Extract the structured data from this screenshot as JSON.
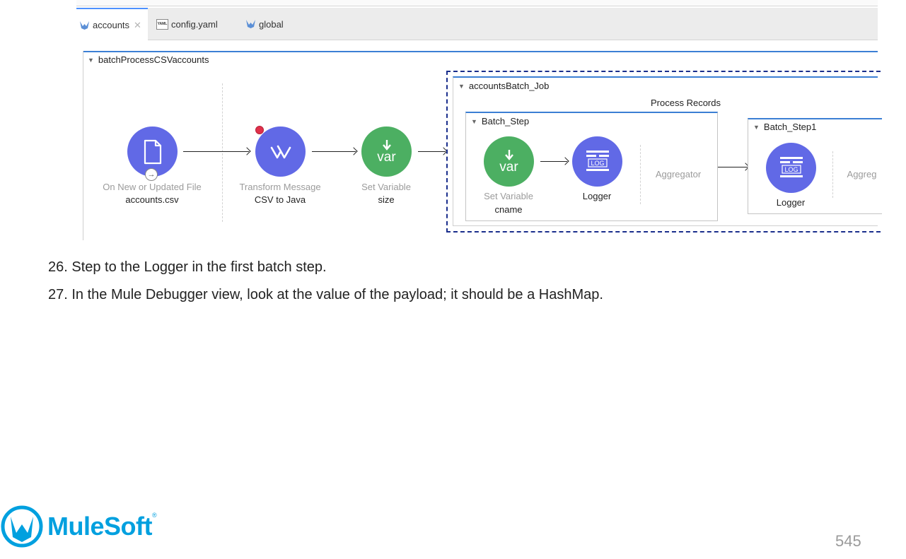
{
  "editor": {
    "tabs": [
      {
        "label": "accounts",
        "icon": "mule-icon",
        "active": true
      },
      {
        "label": "config.yaml",
        "icon": "yaml-file-icon",
        "active": false
      },
      {
        "label": "global",
        "icon": "mule-icon",
        "active": false
      }
    ],
    "close_glyph": "✕"
  },
  "flow": {
    "name": "batchProcessCSVaccounts",
    "components": [
      {
        "type": "On New or Updated File",
        "name": "accounts.csv",
        "icon": "file-icon"
      },
      {
        "type": "Transform Message",
        "name": "CSV to Java",
        "icon": "transform-icon"
      },
      {
        "type": "Set Variable",
        "name": "size",
        "icon": "var-icon",
        "icon_text": "var"
      }
    ],
    "batch_job": {
      "name": "accountsBatch_Job",
      "phase": "Process Records",
      "steps": [
        {
          "name": "Batch_Step",
          "components": [
            {
              "type": "Set Variable",
              "name": "cname",
              "icon": "var-icon",
              "icon_text": "var"
            },
            {
              "type": "",
              "name": "Logger",
              "icon": "logger-icon",
              "icon_text": "LOG"
            }
          ],
          "aggregator": "Aggregator"
        },
        {
          "name": "Batch_Step1",
          "components": [
            {
              "type": "",
              "name": "Logger",
              "icon": "logger-icon",
              "icon_text": "LOG"
            }
          ],
          "aggregator": "Aggreg"
        }
      ]
    }
  },
  "instructions": [
    "26. Step to the Logger in the first batch step.",
    "27. In the Mule Debugger view, look at the value of the payload; it should be a HashMap."
  ],
  "footer": {
    "logo_text": "MuleSoft",
    "trademark": "®",
    "page_number": "545"
  },
  "colors": {
    "processor_blue": "#6169e6",
    "processor_green": "#4caf62",
    "breakpoint_red": "#e0304a",
    "scope_border": "#3c7fd4",
    "batch_dash": "#1a2e8c",
    "brand": "#00a0df"
  }
}
